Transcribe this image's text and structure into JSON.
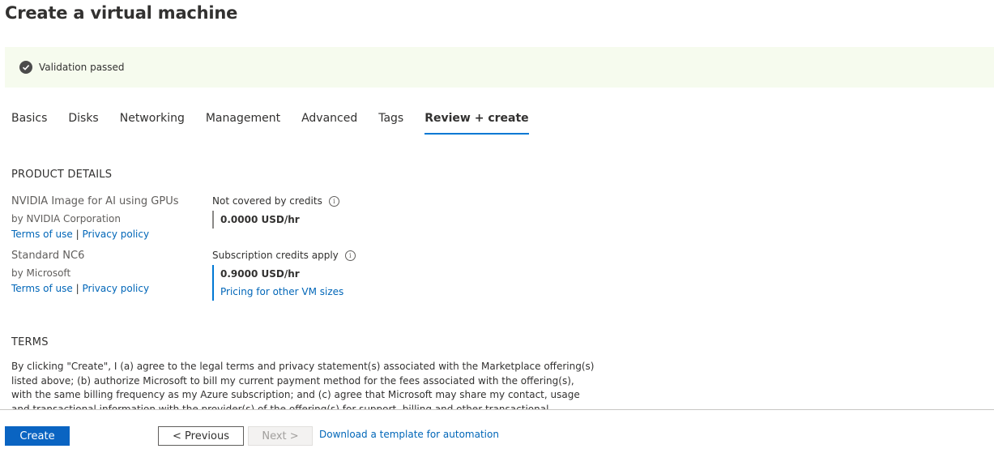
{
  "page": {
    "title": "Create a virtual machine"
  },
  "banner": {
    "text": "Validation passed",
    "icon": "check-circle-icon"
  },
  "tabs": [
    {
      "label": "Basics"
    },
    {
      "label": "Disks"
    },
    {
      "label": "Networking"
    },
    {
      "label": "Management"
    },
    {
      "label": "Advanced"
    },
    {
      "label": "Tags"
    },
    {
      "label": "Review + create",
      "active": true
    }
  ],
  "product_details": {
    "heading": "PRODUCT DETAILS",
    "items": [
      {
        "name": "NVIDIA Image for AI using GPUs",
        "by": "by NVIDIA Corporation",
        "terms_link": "Terms of use",
        "separator": "|",
        "privacy_link": "Privacy policy",
        "price_label": "Not covered by credits",
        "price": "0.0000 USD/hr"
      },
      {
        "name": "Standard NC6",
        "by": "by Microsoft",
        "terms_link": "Terms of use",
        "separator": "|",
        "privacy_link": "Privacy policy",
        "price_label": "Subscription credits apply",
        "price": "0.9000 USD/hr",
        "price_link": "Pricing for other VM sizes"
      }
    ],
    "info_icon_glyph": "i"
  },
  "terms": {
    "heading": "TERMS",
    "text": "By clicking \"Create\", I (a) agree to the legal terms and privacy statement(s) associated with the Marketplace offering(s) listed above; (b) authorize Microsoft to bill my current payment method for the fees associated with the offering(s), with the same billing frequency as my Azure subscription; and (c) agree that Microsoft may share my contact, usage and transactional information with the provider(s) of the offering(s) for support, billing and other transactional activities. Microsoft does not provide rights for third-party offerings."
  },
  "footer": {
    "create_label": "Create",
    "previous_label": "< Previous",
    "next_label": "Next >",
    "download_link": "Download a template for automation"
  },
  "colors": {
    "accent": "#0078d4",
    "link": "#0066b8",
    "banner_bg": "#f6fbee",
    "primary_button": "#0a64c2"
  }
}
